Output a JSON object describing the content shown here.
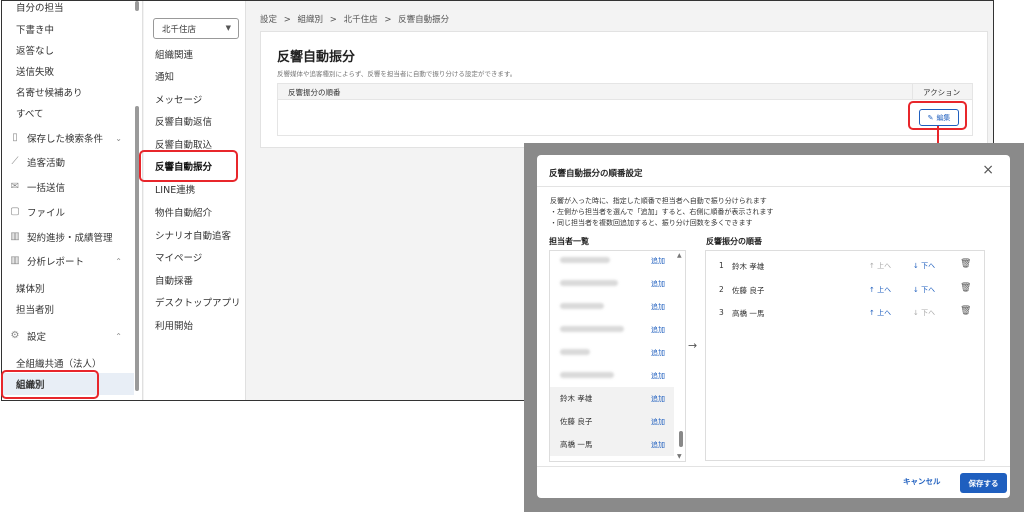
{
  "left_sidebar": {
    "items": [
      {
        "label": "自分の担当"
      },
      {
        "label": "下書き中"
      },
      {
        "label": "返答なし"
      },
      {
        "label": "送信失敗"
      },
      {
        "label": "名寄せ候補あり"
      },
      {
        "label": "すべて"
      },
      {
        "label": "保存した検索条件",
        "icon": "bookmark-icon"
      },
      {
        "label": "追客活動",
        "icon": "activity-icon"
      },
      {
        "label": "一括送信",
        "icon": "mail-icon"
      },
      {
        "label": "ファイル",
        "icon": "file-icon"
      },
      {
        "label": "契約進捗・成績管理",
        "icon": "chart-icon"
      },
      {
        "label": "分析レポート",
        "icon": "report-icon"
      },
      {
        "label": "媒体別"
      },
      {
        "label": "担当者別"
      },
      {
        "label": "設定",
        "icon": "gear-icon"
      },
      {
        "label": "全組織共通（法人）"
      },
      {
        "label": "組織別"
      }
    ]
  },
  "mid_sidebar": {
    "store": "北千住店",
    "items": [
      "組織関連",
      "通知",
      "メッセージ",
      "反響自動返信",
      "反響自動取込",
      "反響自動振分",
      "LINE連携",
      "物件自動紹介",
      "シナリオ自動追客",
      "マイページ",
      "自動採番",
      "デスクトップアプリ",
      "利用開始"
    ]
  },
  "breadcrumb": [
    "設定",
    ">",
    "組織別",
    ">",
    "北千住店",
    ">",
    "反響自動振分"
  ],
  "main": {
    "title": "反響自動振分",
    "description": "反響媒体や追客種別によらず、反響を担当者に自動で振り分ける設定ができます。",
    "col_order": "反響振分の順番",
    "col_action": "アクション",
    "edit_label": "編集"
  },
  "modal": {
    "title": "反響自動振分の順番設定",
    "close": "×",
    "desc": [
      "反響が入った時に、指定した順番で担当者へ自動で振り分けられます",
      "・左側から担当者を選んで「追加」すると、右側に順番が表示されます",
      "・同じ担当者を複数回追加すると、振り分け回数を多くできます"
    ],
    "left_title": "担当者一覧",
    "right_title": "反響振分の順番",
    "add_label": "追加",
    "staff_visible": [
      "鈴木 孝雄",
      "佐藤 良子",
      "高橋 一馬"
    ],
    "order": [
      {
        "num": "1",
        "name": "鈴木 孝雄",
        "up": "上へ",
        "down": "下へ",
        "up_enabled": false,
        "down_enabled": true
      },
      {
        "num": "2",
        "name": "佐藤 良子",
        "up": "上へ",
        "down": "下へ",
        "up_enabled": true,
        "down_enabled": true
      },
      {
        "num": "3",
        "name": "高橋 一馬",
        "up": "上へ",
        "down": "下へ",
        "up_enabled": true,
        "down_enabled": false
      }
    ],
    "cancel": "キャンセル",
    "save": "保存する"
  },
  "colors": {
    "accent": "#1f5fbf",
    "highlight": "#e8262b"
  }
}
